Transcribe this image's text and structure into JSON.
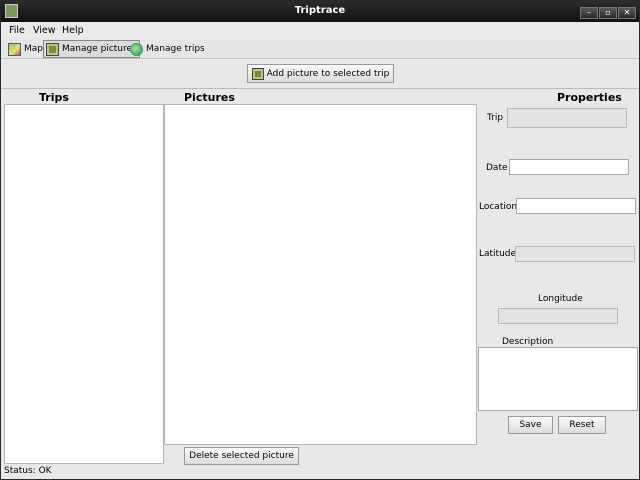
{
  "window": {
    "title": "Triptrace",
    "minimize": "–",
    "maximize": "▫",
    "close": "✕"
  },
  "menu": [
    "File",
    "View",
    "Help"
  ],
  "toolbar": {
    "map": "Map",
    "manage_pictures": "Manage pictures",
    "manage_trips": "Manage trips"
  },
  "actions": {
    "add_picture": "Add picture to selected trip",
    "delete_picture": "Delete selected picture",
    "save": "Save",
    "reset": "Reset"
  },
  "headers": {
    "trips": "Trips",
    "pictures": "Pictures",
    "properties": "Properties"
  },
  "properties": {
    "trip": "Trip",
    "date": "Date",
    "location": "Location",
    "latitude": "Latitude",
    "longitude": "Longitude",
    "description": "Description"
  },
  "status": "Status: OK"
}
